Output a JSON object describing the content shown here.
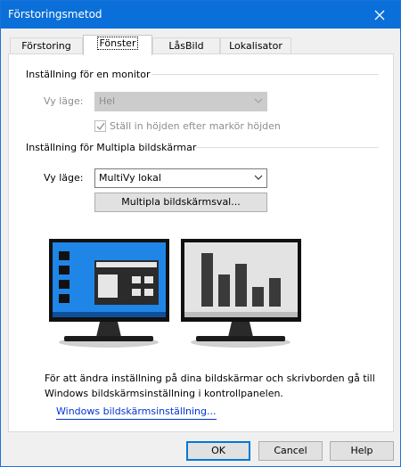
{
  "window": {
    "title": "Förstoringsmetod"
  },
  "tabs": [
    {
      "label": "Förstoring"
    },
    {
      "label": "Fönster"
    },
    {
      "label": "LåsBild"
    },
    {
      "label": "Lokalisator"
    }
  ],
  "single_monitor": {
    "heading": "Inställning för en monitor",
    "view_mode_label": "Vy läge:",
    "view_mode_value": "Hel",
    "checkbox_label": "Ställ in höjden efter markör höjden",
    "checkbox_checked": true
  },
  "multi_monitor": {
    "heading": "Inställning för Multipla bildskärmar",
    "view_mode_label": "Vy läge:",
    "view_mode_value": "MultiVy lokal",
    "select_button": "Multipla bildskärmsval..."
  },
  "info": {
    "line1": "För att ändra inställning på dina bildskärmar och skrivborden gå till",
    "line2": "Windows bildskärmsinställning i kontrollpanelen.",
    "link": "Windows bildskärmsinställning..."
  },
  "buttons": {
    "ok": "OK",
    "cancel": "Cancel",
    "help": "Help"
  },
  "colors": {
    "titlebar": "#0a6fd8",
    "accent": "#0078d7",
    "monitor_left_screen": "#1f86e8",
    "link": "#0035d4"
  }
}
